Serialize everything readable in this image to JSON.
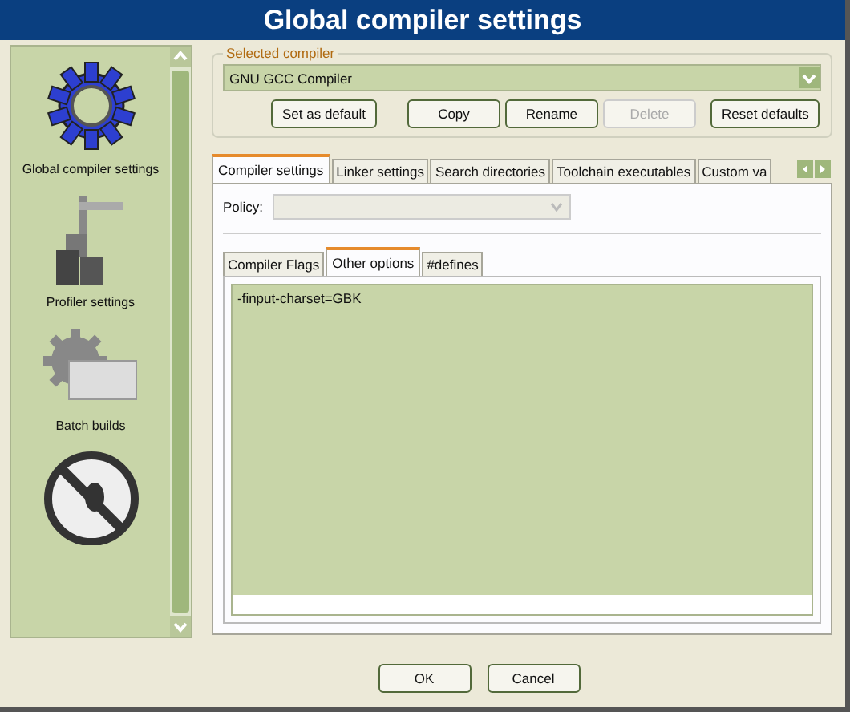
{
  "window": {
    "title": "Global compiler settings"
  },
  "sidebar": {
    "items": [
      {
        "kind": "gear",
        "label": "Global compiler settings"
      },
      {
        "kind": "caliper",
        "label": "Profiler settings"
      },
      {
        "kind": "gearbox",
        "label": "Batch builds"
      },
      {
        "kind": "nobug"
      }
    ]
  },
  "selected_compiler": {
    "legend": "Selected compiler",
    "value": "GNU GCC Compiler"
  },
  "compiler_buttons": [
    {
      "label": "Set as default",
      "disabled": false
    },
    {
      "label": "Copy",
      "disabled": false
    },
    {
      "label": "Rename",
      "disabled": false
    },
    {
      "label": "Delete",
      "disabled": true
    },
    {
      "label": "Reset defaults",
      "disabled": false
    }
  ],
  "tabs": [
    {
      "label": "Compiler settings",
      "selected": true
    },
    {
      "label": "Linker settings",
      "selected": false
    },
    {
      "label": "Search directories",
      "selected": false
    },
    {
      "label": "Toolchain executables",
      "selected": false
    },
    {
      "label": "Custom va",
      "selected": false
    }
  ],
  "policy": {
    "label": "Policy:",
    "disabled": true
  },
  "sub_tabs": [
    {
      "label": "Compiler Flags",
      "selected": false
    },
    {
      "label": "Other options",
      "selected": true
    },
    {
      "label": "#defines",
      "selected": false
    }
  ],
  "other_options": {
    "value": "-finput-charset=GBK"
  },
  "buttons": [
    "OK",
    "Cancel"
  ]
}
